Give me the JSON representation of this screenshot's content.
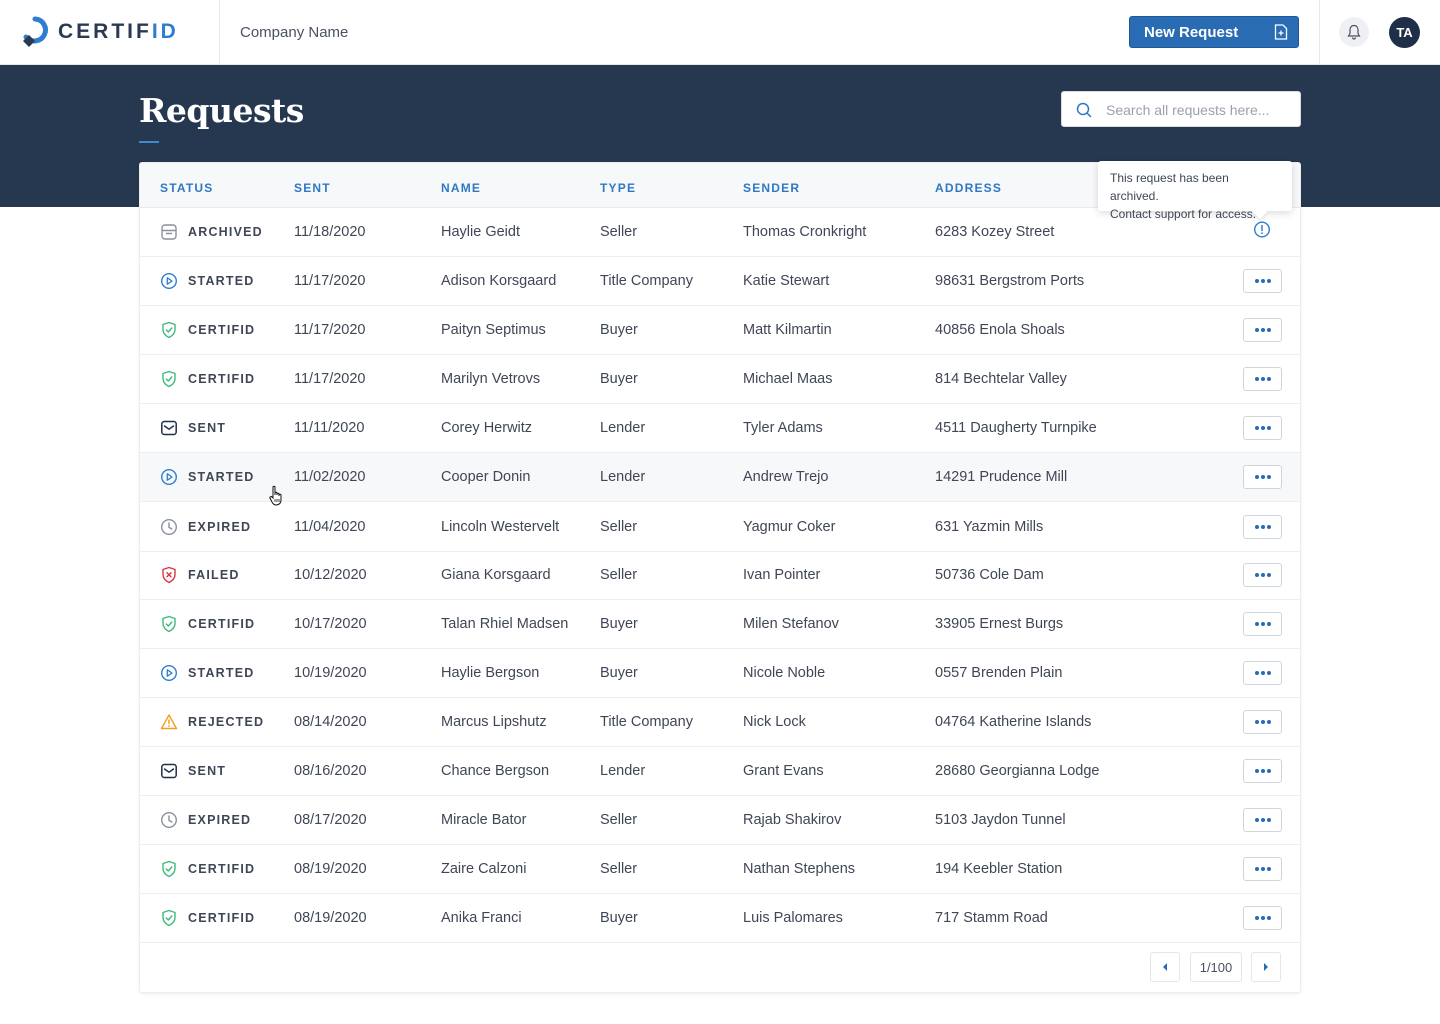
{
  "app": {
    "logo_text_main": "CERTIF",
    "logo_text_accent": "ID",
    "company": "Company Name",
    "new_request_label": "New Request",
    "avatar_initials": "TA"
  },
  "page": {
    "title": "Requests",
    "search_placeholder": "Search all requests here..."
  },
  "table": {
    "headers": {
      "status": "STATUS",
      "sent": "SENT",
      "name": "NAME",
      "type": "TYPE",
      "sender": "SENDER",
      "address": "ADDRESS"
    },
    "rows": [
      {
        "status": "ARCHIVED",
        "icon": "archive-icon",
        "sent": "11/18/2020",
        "name": "Haylie Geidt",
        "type": "Seller",
        "sender": "Thomas Cronkright",
        "address": "6283 Kozey Street"
      },
      {
        "status": "STARTED",
        "icon": "play-icon",
        "sent": "11/17/2020",
        "name": "Adison Korsgaard",
        "type": "Title Company",
        "sender": "Katie Stewart",
        "address": "98631 Bergstrom Ports"
      },
      {
        "status": "CERTIFID",
        "icon": "shield-check-icon",
        "sent": "11/17/2020",
        "name": "Paityn Septimus",
        "type": "Buyer",
        "sender": "Matt Kilmartin",
        "address": "40856 Enola Shoals"
      },
      {
        "status": "CERTIFID",
        "icon": "shield-check-icon",
        "sent": "11/17/2020",
        "name": "Marilyn Vetrovs",
        "type": "Buyer",
        "sender": "Michael Maas",
        "address": "814 Bechtelar Valley"
      },
      {
        "status": "SENT",
        "icon": "envelope-icon",
        "sent": "11/11/2020",
        "name": "Corey Herwitz",
        "type": "Lender",
        "sender": "Tyler Adams",
        "address": "4511 Daugherty Turnpike"
      },
      {
        "status": "STARTED",
        "icon": "play-icon",
        "sent": "11/02/2020",
        "name": "Cooper Donin",
        "type": "Lender",
        "sender": "Andrew Trejo",
        "address": "14291 Prudence Mill"
      },
      {
        "status": "EXPIRED",
        "icon": "clock-icon",
        "sent": "11/04/2020",
        "name": "Lincoln Westervelt",
        "type": "Seller",
        "sender": "Yagmur Coker",
        "address": "631 Yazmin Mills"
      },
      {
        "status": "FAILED",
        "icon": "shield-x-icon",
        "sent": "10/12/2020",
        "name": "Giana Korsgaard",
        "type": "Seller",
        "sender": "Ivan Pointer",
        "address": "50736 Cole Dam"
      },
      {
        "status": "CERTIFID",
        "icon": "shield-check-icon",
        "sent": "10/17/2020",
        "name": "Talan Rhiel Madsen",
        "type": "Buyer",
        "sender": "Milen Stefanov",
        "address": "33905 Ernest Burgs"
      },
      {
        "status": "STARTED",
        "icon": "play-icon",
        "sent": "10/19/2020",
        "name": "Haylie Bergson",
        "type": "Buyer",
        "sender": "Nicole Noble",
        "address": "0557 Brenden Plain"
      },
      {
        "status": "REJECTED",
        "icon": "warning-icon",
        "sent": "08/14/2020",
        "name": "Marcus Lipshutz",
        "type": "Title Company",
        "sender": "Nick Lock",
        "address": "04764 Katherine Islands"
      },
      {
        "status": "SENT",
        "icon": "envelope-icon",
        "sent": "08/16/2020",
        "name": "Chance Bergson",
        "type": "Lender",
        "sender": "Grant Evans",
        "address": "28680 Georgianna Lodge"
      },
      {
        "status": "EXPIRED",
        "icon": "clock-icon",
        "sent": "08/17/2020",
        "name": "Miracle Bator",
        "type": "Seller",
        "sender": "Rajab Shakirov",
        "address": "5103 Jaydon Tunnel"
      },
      {
        "status": "CERTIFID",
        "icon": "shield-check-icon",
        "sent": "08/19/2020",
        "name": "Zaire Calzoni",
        "type": "Seller",
        "sender": "Nathan Stephens",
        "address": "194 Keebler Station"
      },
      {
        "status": "CERTIFID",
        "icon": "shield-check-icon",
        "sent": "08/19/2020",
        "name": "Anika Franci",
        "type": "Buyer",
        "sender": "Luis Palomares",
        "address": "717 Stamm Road"
      }
    ]
  },
  "tooltip": {
    "line1": "This request has been archived.",
    "line2": "Contact support for access."
  },
  "pagination": {
    "label": "1/100"
  },
  "colors": {
    "primary": "#2a6cb3",
    "header_band": "#25384f",
    "certifid_green": "#3fb97a",
    "failed_red": "#d9343f",
    "rejected_orange": "#f0a020",
    "started_blue": "#2f7dd1",
    "neutral_gray": "#8a919c"
  }
}
